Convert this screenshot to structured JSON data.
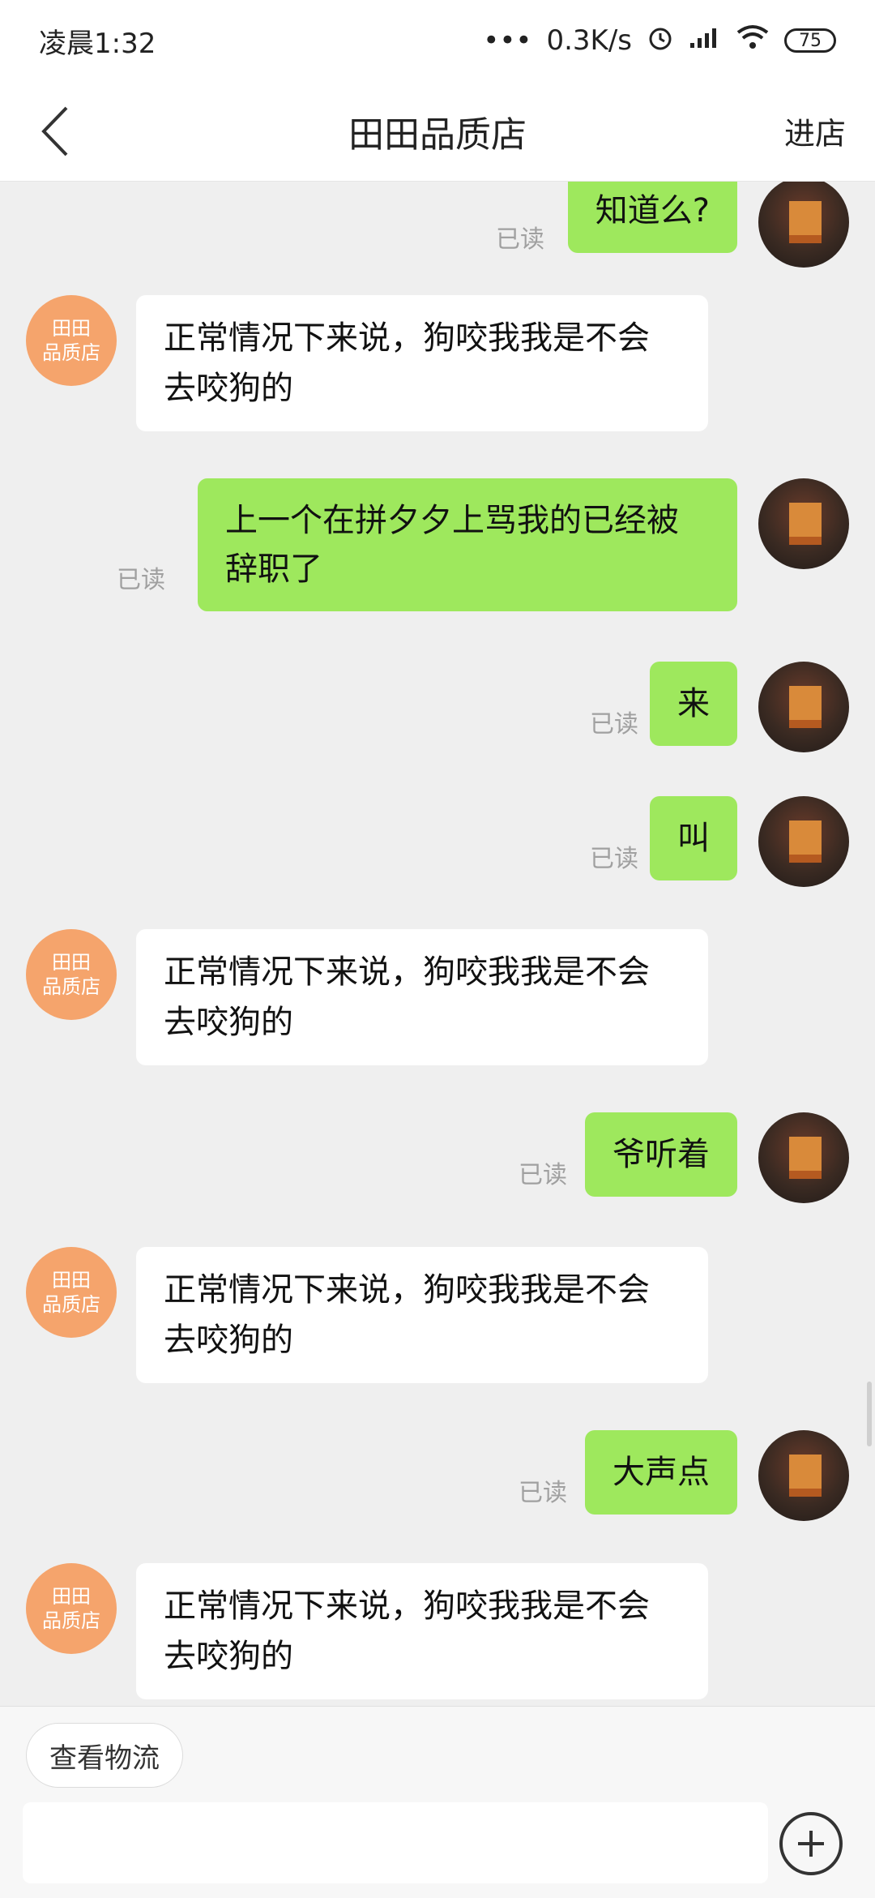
{
  "status_bar": {
    "time": "凌晨1:32",
    "network_speed": "0.3K/s",
    "battery": "75"
  },
  "header": {
    "title": "田田品质店",
    "enter_store": "进店"
  },
  "shop_avatar": {
    "line1": "田田",
    "line2": "品质店"
  },
  "messages": [
    {
      "sender": "self",
      "text": "知道么?",
      "status": "已读"
    },
    {
      "sender": "shop",
      "text": "正常情况下来说，狗咬我我是不会去咬狗的"
    },
    {
      "sender": "self",
      "text": "上一个在拼夕夕上骂我的已经被辞职了",
      "status": "已读"
    },
    {
      "sender": "self",
      "text": "来",
      "status": "已读"
    },
    {
      "sender": "self",
      "text": "叫",
      "status": "已读"
    },
    {
      "sender": "shop",
      "text": "正常情况下来说，狗咬我我是不会去咬狗的"
    },
    {
      "sender": "self",
      "text": "爷听着",
      "status": "已读"
    },
    {
      "sender": "shop",
      "text": "正常情况下来说，狗咬我我是不会去咬狗的"
    },
    {
      "sender": "self",
      "text": "大声点",
      "status": "已读"
    },
    {
      "sender": "shop",
      "text": "正常情况下来说，狗咬我我是不会去咬狗的"
    }
  ],
  "bottom": {
    "logistics_button": "查看物流",
    "input_placeholder": "",
    "plus_icon": "plus-circle-icon"
  }
}
